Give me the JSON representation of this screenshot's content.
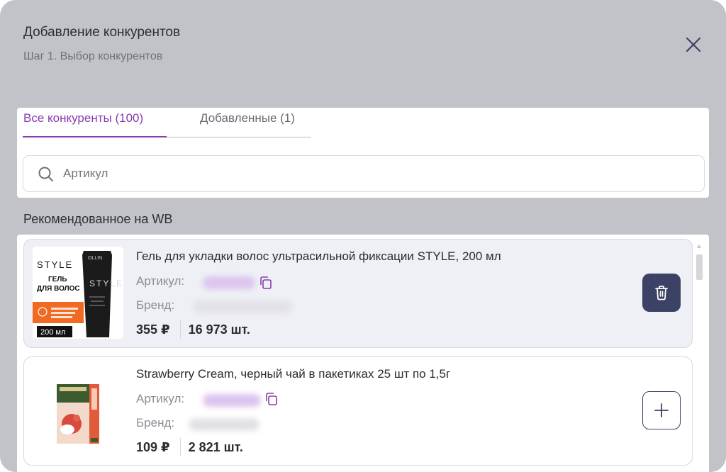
{
  "modal": {
    "title": "Добавление конкурентов",
    "subtitle": "Шаг 1. Выбор конкурентов"
  },
  "tabs": [
    {
      "label": "Все конкуренты (100)",
      "active": true
    },
    {
      "label": "Добавленные (1)",
      "active": false
    }
  ],
  "search": {
    "placeholder": "Артикул",
    "value": ""
  },
  "section_title": "Рекомендованное на WB",
  "products": [
    {
      "name": "Гель для укладки волос ультрасильной фиксации STYLE, 200 мл",
      "article_label": "Артикул:",
      "brand_label": "Бренд:",
      "price": "355 ₽",
      "quantity": "16 973 шт.",
      "added": true,
      "action_icon": "trash-icon",
      "thumb": {
        "brand_top": "STYLE",
        "line1": "ГЕЛЬ",
        "line2": "ДЛЯ ВОЛОС",
        "badge": "200 мл",
        "tube_brand": "OLLIN",
        "tube_text": "STYLE"
      }
    },
    {
      "name": "Strawberry Cream, черный чай в пакетиках 25 шт по 1,5г",
      "article_label": "Артикул:",
      "brand_label": "Бренд:",
      "price": "109 ₽",
      "quantity": "2 821 шт.",
      "added": false,
      "action_icon": "plus-icon"
    }
  ],
  "colors": {
    "accent": "#8a3bb0",
    "primary_button": "#3b4266",
    "overlay": "#c2c3c8",
    "blurred_article": "#dcc4ef",
    "blurred_brand": "#e2e2e6"
  }
}
